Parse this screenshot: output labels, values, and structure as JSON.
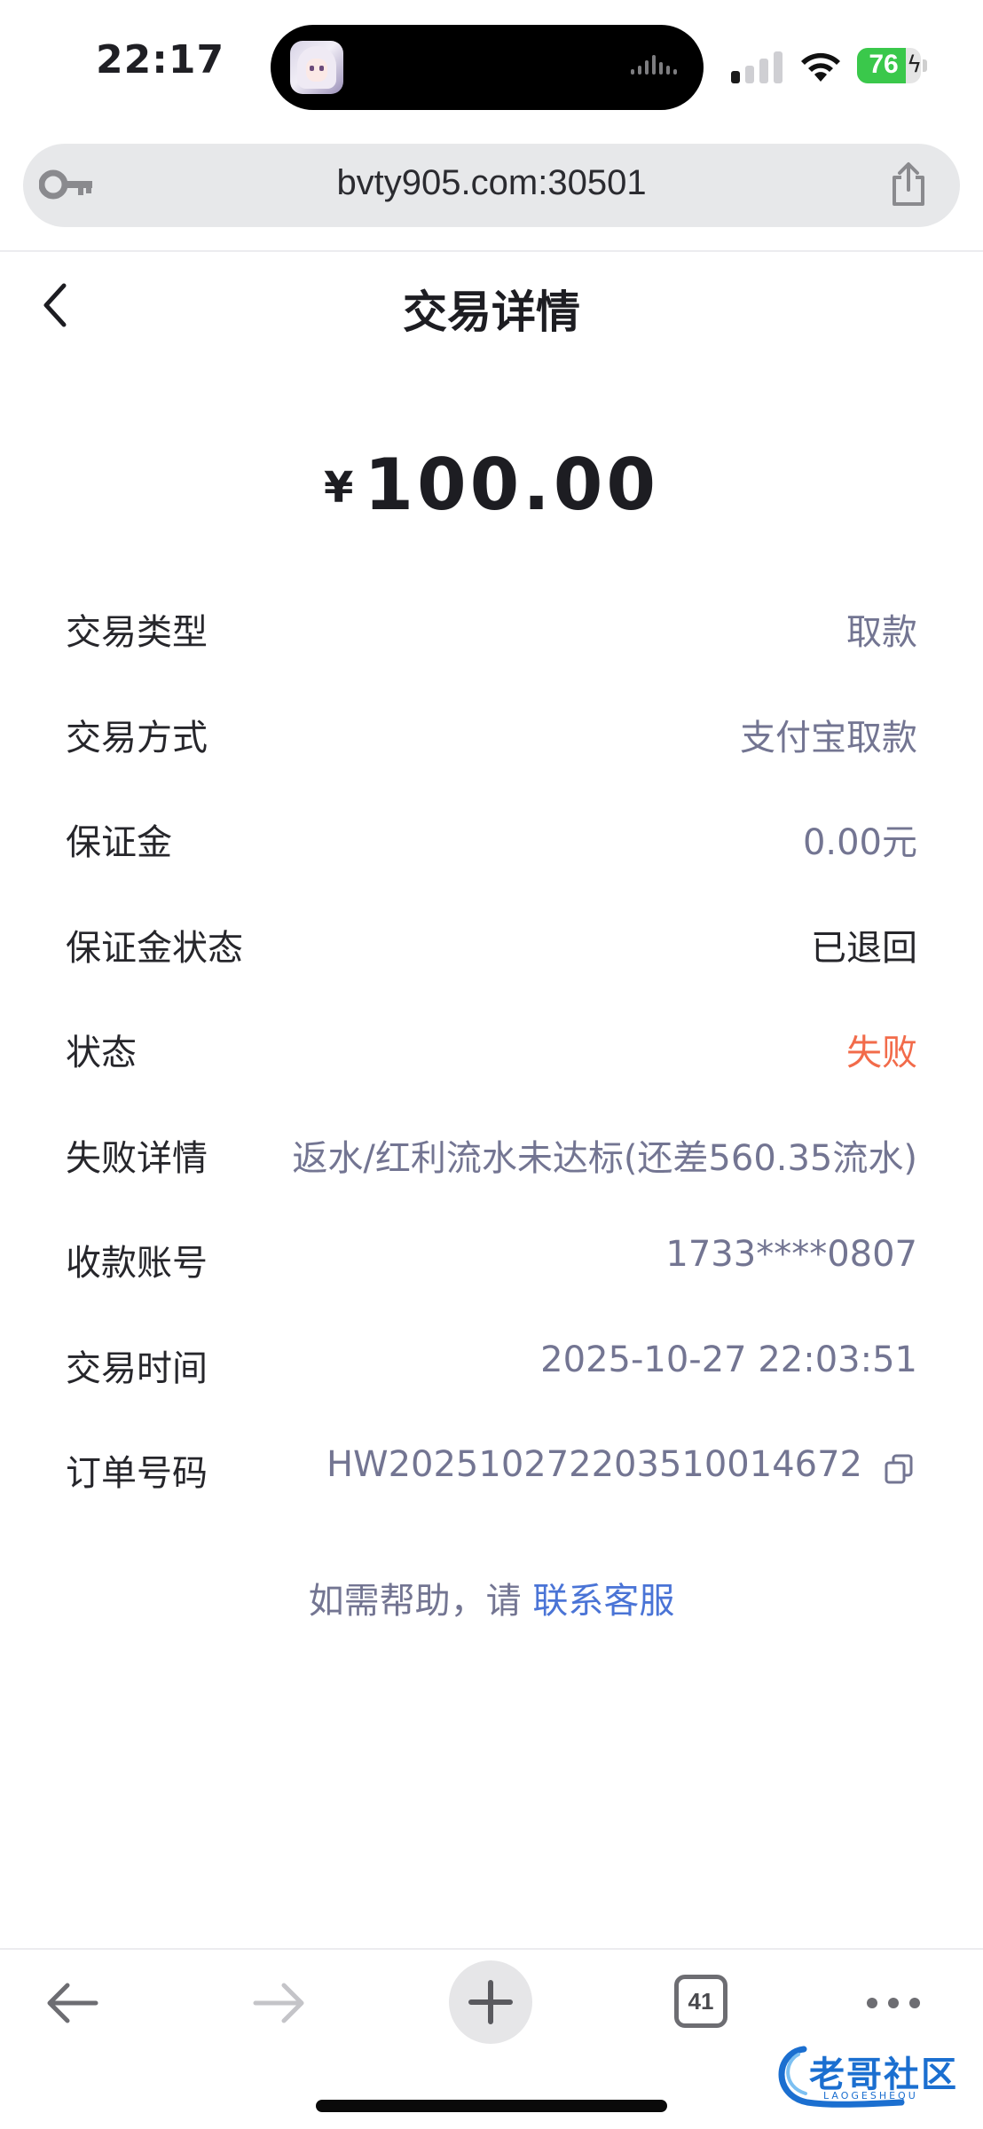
{
  "status_bar": {
    "time": "22:17",
    "battery": "76",
    "battery_level": 0.76,
    "icons": [
      "signal-icon",
      "wifi-icon",
      "battery-icon"
    ]
  },
  "browser": {
    "url": "bvty905.com:30501",
    "icons": [
      "key-icon",
      "share-icon"
    ]
  },
  "header": {
    "title": "交易详情"
  },
  "amount": {
    "currency": "¥",
    "value": "100.00"
  },
  "details": [
    {
      "label": "交易类型",
      "value": "取款"
    },
    {
      "label": "交易方式",
      "value": "支付宝取款"
    },
    {
      "label": "保证金",
      "value": "0.00元"
    },
    {
      "label": "保证金状态",
      "value": "已退回"
    },
    {
      "label": "状态",
      "value": "失败"
    },
    {
      "label": "失败详情",
      "value": "返水/红利流水未达标(还差560.35流水)"
    },
    {
      "label": "收款账号",
      "value": "1733****0807"
    },
    {
      "label": "交易时间",
      "value": "2025-10-27 22:03:51"
    },
    {
      "label": "订单号码",
      "value": "HW20251027220351001467​2"
    }
  ],
  "help": {
    "prefix": "如需帮助，请 ",
    "link": "联系客服"
  },
  "toolbar": {
    "tab_count": "41"
  },
  "watermark": {
    "text": "老哥社区",
    "sub": "LAOGESHEQU"
  },
  "colors": {
    "fail": "#f26b4a",
    "link": "#4a74d6",
    "muted": "#737592",
    "battery": "#3ac84b"
  }
}
